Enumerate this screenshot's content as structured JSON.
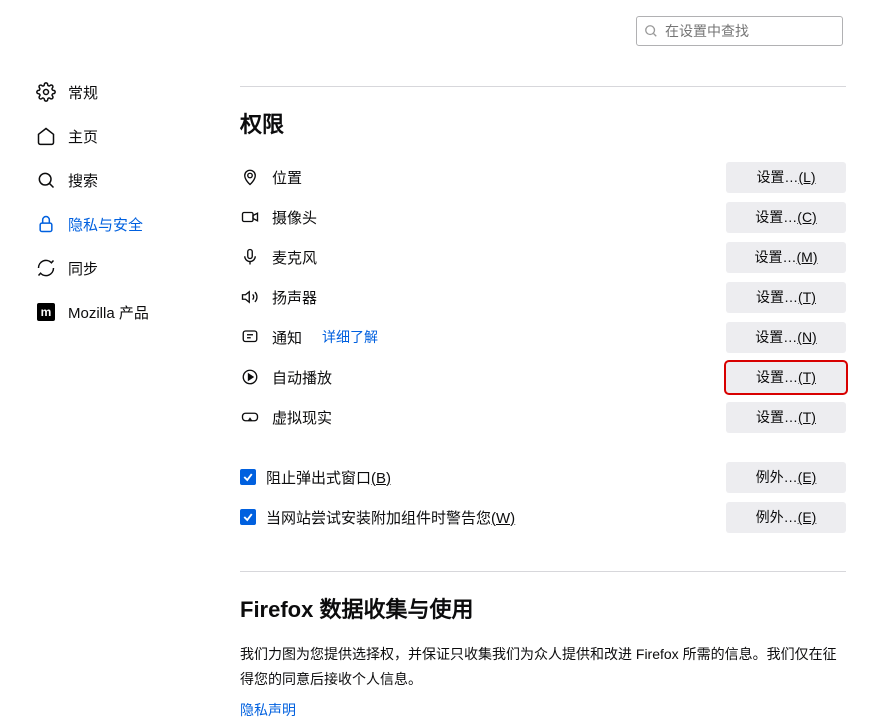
{
  "search": {
    "placeholder": "在设置中查找"
  },
  "sidebar": {
    "general": "常规",
    "home": "主页",
    "search": "搜索",
    "privacy": "隐私与安全",
    "sync": "同步",
    "mozilla": "Mozilla 产品"
  },
  "permissions": {
    "title": "权限",
    "rows": {
      "location": {
        "label": "位置",
        "btn": "设置…",
        "key": "(L)"
      },
      "camera": {
        "label": "摄像头",
        "btn": "设置…",
        "key": "(C)"
      },
      "microphone": {
        "label": "麦克风",
        "btn": "设置…",
        "key": "(M)"
      },
      "speaker": {
        "label": "扬声器",
        "btn": "设置…",
        "key": "(T)"
      },
      "notification": {
        "label": "通知",
        "link": "详细了解",
        "btn": "设置…",
        "key": "(N)"
      },
      "autoplay": {
        "label": "自动播放",
        "btn": "设置…",
        "key": "(T)"
      },
      "vr": {
        "label": "虚拟现实",
        "btn": "设置…",
        "key": "(T)"
      }
    },
    "checkboxes": {
      "popup": {
        "label": "阻止弹出式窗口",
        "key": "(B)",
        "btn": "例外…",
        "btnkey": "(E)"
      },
      "addon": {
        "label": "当网站尝试安装附加组件时警告您",
        "key": "(W)",
        "btn": "例外…",
        "btnkey": "(E)"
      }
    }
  },
  "data": {
    "title": "Firefox 数据收集与使用",
    "desc": "我们力图为您提供选择权，并保证只收集我们为众人提供和改进 Firefox 所需的信息。我们仅在征得您的同意后接收个人信息。",
    "link": "隐私声明"
  }
}
